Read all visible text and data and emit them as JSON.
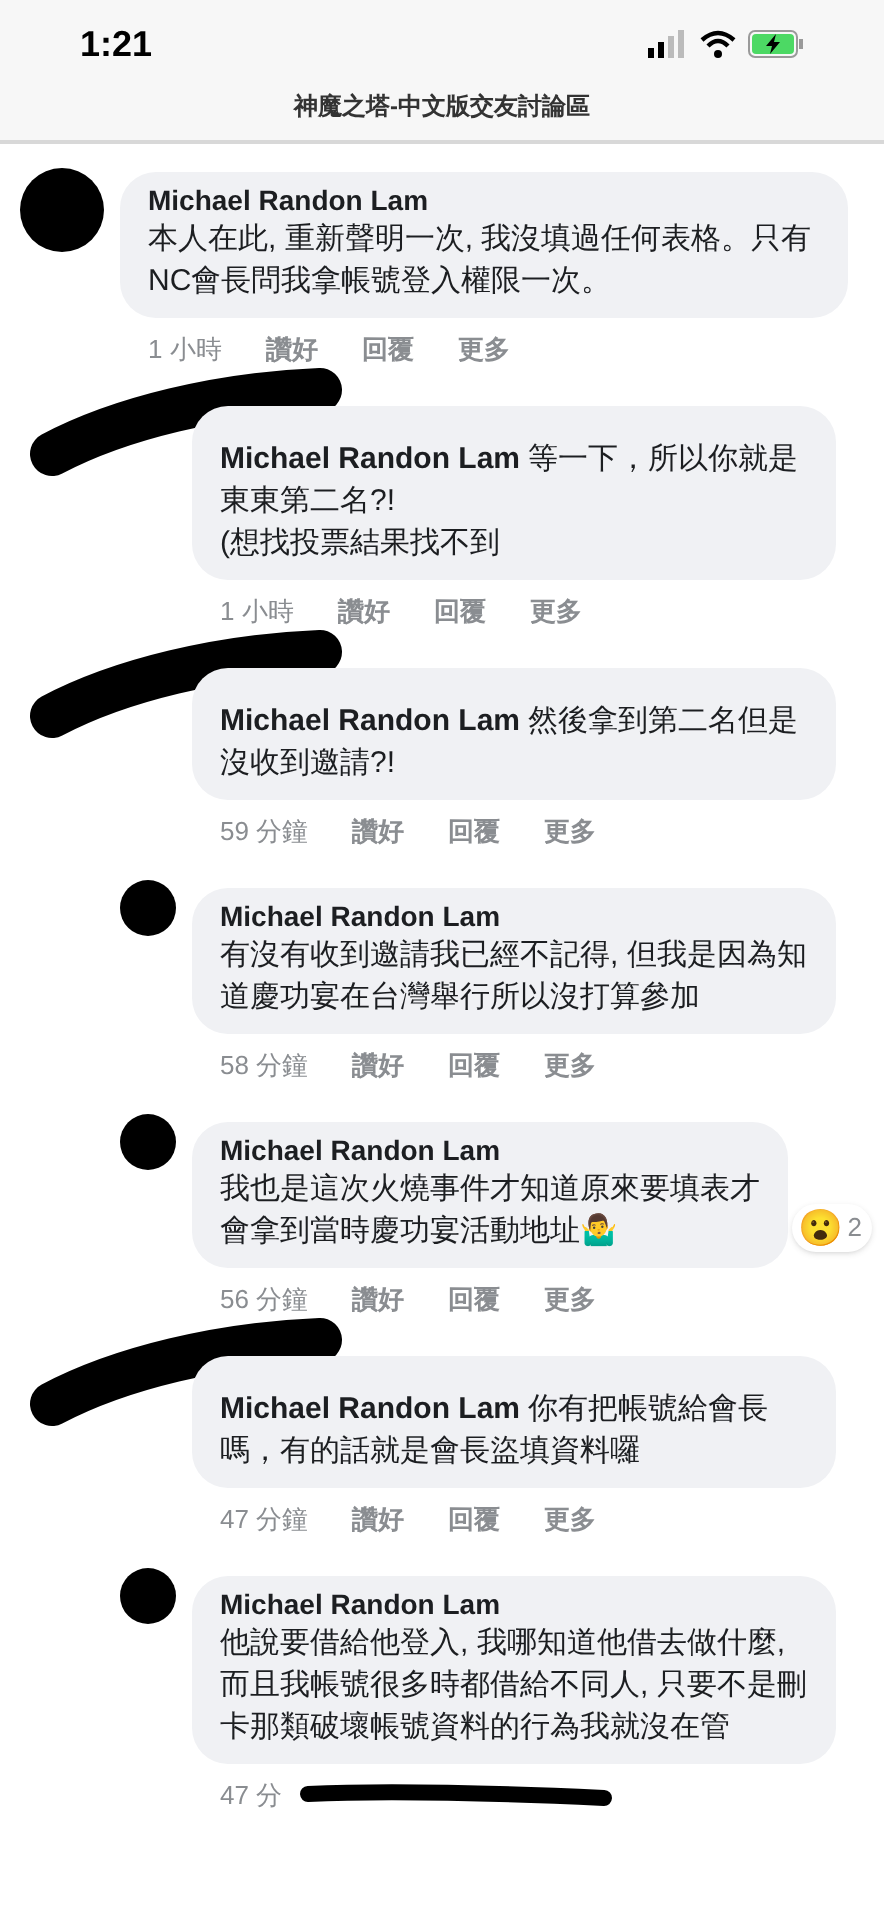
{
  "status_bar": {
    "time": "1:21"
  },
  "header": {
    "title": "神魔之塔-中文版交友討論區"
  },
  "comments": [
    {
      "kind": "top",
      "redacted": false,
      "author": "Michael Randon Lam",
      "body": "本人在此, 重新聲明一次, 我沒填過任何表格。只有NC會長問我拿帳號登入權限一次。",
      "time": "1 小時",
      "actions": [
        "讚好",
        "回覆",
        "更多"
      ]
    },
    {
      "kind": "reply",
      "redacted": true,
      "body": "**Michael Randon Lam** 等一下，所以你就是東東第二名?!\n(想找投票結果找不到",
      "time": "1 小時",
      "actions": [
        "讚好",
        "回覆",
        "更多"
      ]
    },
    {
      "kind": "reply",
      "redacted": true,
      "body": "**Michael Randon Lam** 然後拿到第二名但是沒收到邀請?!",
      "time": "59 分鐘",
      "actions": [
        "讚好",
        "回覆",
        "更多"
      ]
    },
    {
      "kind": "reply",
      "redacted": false,
      "author": "Michael Randon Lam",
      "body": "有沒有收到邀請我已經不記得, 但我是因為知道慶功宴在台灣舉行所以沒打算參加",
      "time": "58 分鐘",
      "actions": [
        "讚好",
        "回覆",
        "更多"
      ]
    },
    {
      "kind": "reply",
      "redacted": false,
      "author": "Michael Randon Lam",
      "body": "我也是這次火燒事件才知道原來要填表才會拿到當時慶功宴活動地址🤷‍♂️",
      "reaction": {
        "emoji": "😮",
        "count": "2"
      },
      "time": "56 分鐘",
      "actions": [
        "讚好",
        "回覆",
        "更多"
      ]
    },
    {
      "kind": "reply",
      "redacted": true,
      "body": "**Michael Randon Lam** 你有把帳號給會長嗎，有的話就是會長盜填資料囉",
      "time": "47 分鐘",
      "actions": [
        "讚好",
        "回覆",
        "更多"
      ]
    },
    {
      "kind": "reply",
      "redacted": false,
      "author": "Michael Randon Lam",
      "body": "他說要借給他登入, 我哪知道他借去做什麼, 而且我帳號很多時都借給不同人, 只要不是刪卡那類破壞帳號資料的行為我就沒在管",
      "time": "47 分",
      "footer_redacted": true
    }
  ]
}
